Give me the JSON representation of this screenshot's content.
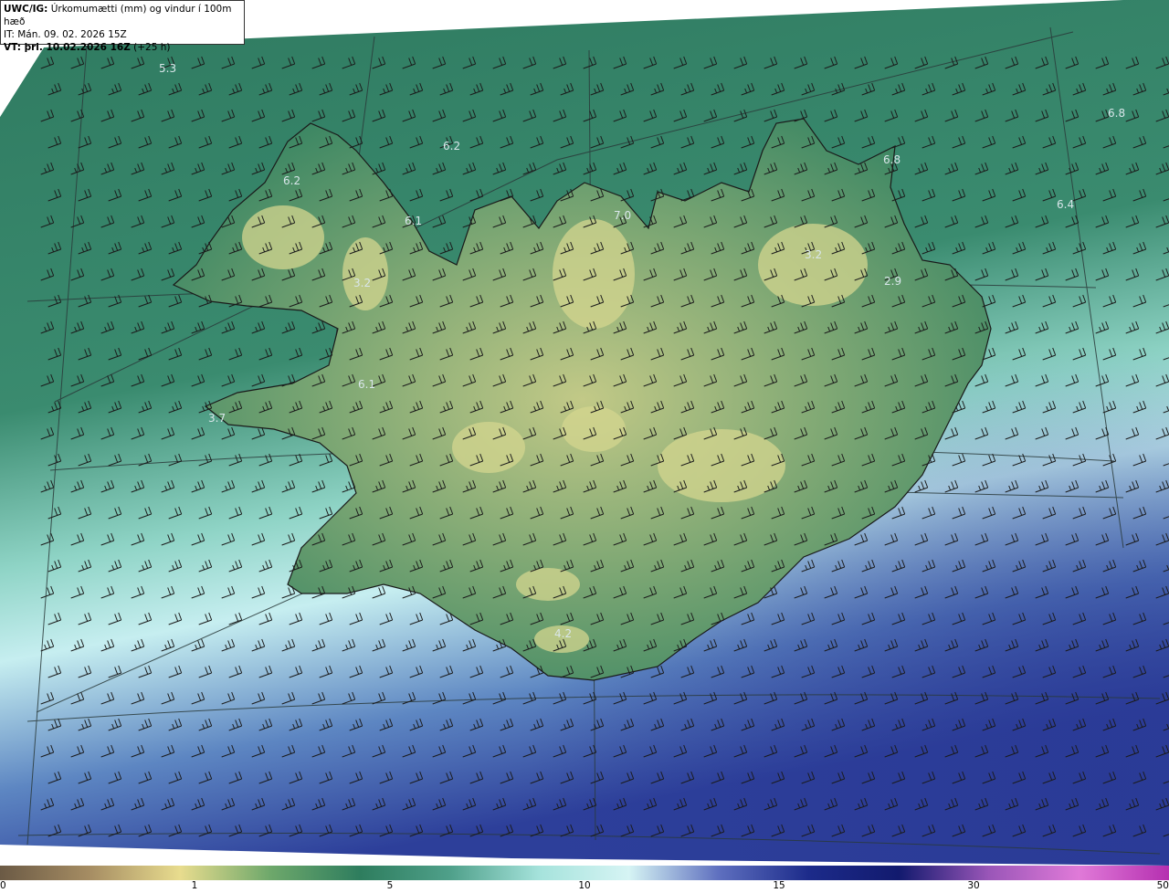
{
  "header": {
    "title_bold": "UWC/IG:",
    "title_rest": "Úrkomumætti (mm) og vindur í 100m hæð",
    "it_line": "IT: Mán. 09. 02. 2026 15Z",
    "vt_bold": "VT: þri. 10.02.2026 16Z",
    "vt_rest": "(+25 h)"
  },
  "map_values": [
    {
      "label": "5.3"
    },
    {
      "label": "6.2"
    },
    {
      "label": "6.2"
    },
    {
      "label": "6.1"
    },
    {
      "label": "7.0"
    },
    {
      "label": "6.8"
    },
    {
      "label": "6.8"
    },
    {
      "label": "6.4"
    },
    {
      "label": "3.2"
    },
    {
      "label": "3.2"
    },
    {
      "label": "2.9"
    },
    {
      "label": "6.1"
    },
    {
      "label": "3.7"
    },
    {
      "label": "4.2"
    }
  ],
  "colorbar": {
    "ticks": [
      "0",
      "1",
      "5",
      "10",
      "15",
      "30",
      "50"
    ],
    "colors": [
      "#6b5a45",
      "#a68d63",
      "#e8dc8e",
      "#6ea86b",
      "#2e7d5e",
      "#4fa08a",
      "#a6e3dc",
      "#d6f4f4",
      "#5e6fbf",
      "#1c2b8a",
      "#121a6e",
      "#9a56b8",
      "#e07ad8",
      "#b52fb0"
    ]
  },
  "wind_unit_note": "",
  "colors": {
    "land_low": "#2f7f5c",
    "land_high": "#c9cf86",
    "sea_near": "#3f8f74",
    "sea_far": "#4c62b0"
  }
}
